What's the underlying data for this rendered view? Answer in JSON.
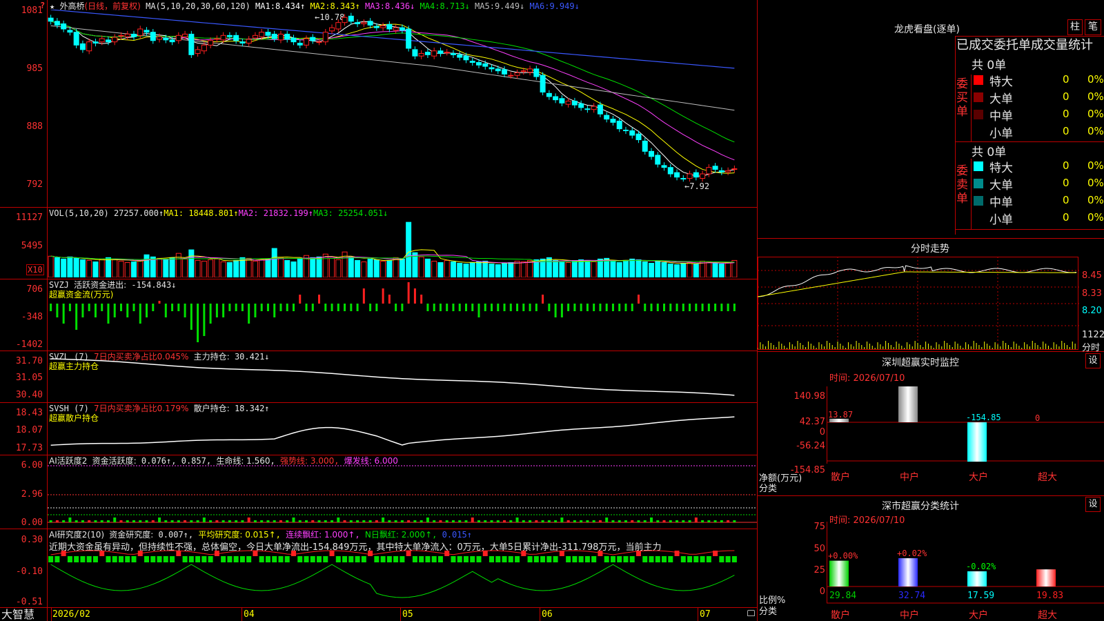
{
  "kline": {
    "star": "★",
    "name": "外高桥",
    "period": "(日线，前复权)",
    "ma_label": "MA(5,10,20,30,60,120)",
    "mas": [
      {
        "label": "MA1:",
        "value": "8.434↑",
        "color": "#ffffff"
      },
      {
        "label": "MA2:",
        "value": "8.343↑",
        "color": "#ffff00"
      },
      {
        "label": "MA3:",
        "value": "8.436↓",
        "color": "#ff40ff"
      },
      {
        "label": "MA4:",
        "value": "8.713↓",
        "color": "#00e000"
      },
      {
        "label": "MA5:",
        "value": "9.449↓",
        "color": "#bdbdbd"
      },
      {
        "label": "MA6:",
        "value": "9.949↓",
        "color": "#3a58ff"
      }
    ],
    "y_ticks": [
      "1081",
      "985",
      "888",
      "792"
    ],
    "high_mark": "←10.78",
    "low_mark": "←7.92",
    "close_series": [
      10.72,
      10.66,
      10.6,
      10.55,
      10.35,
      10.28,
      10.4,
      10.38,
      10.45,
      10.4,
      10.47,
      10.5,
      10.52,
      10.48,
      10.6,
      10.55,
      10.42,
      10.48,
      10.43,
      10.4,
      10.5,
      10.52,
      10.2,
      10.28,
      10.35,
      10.42,
      10.45,
      10.5,
      10.48,
      10.42,
      10.38,
      10.44,
      10.5,
      10.55,
      10.5,
      10.45,
      10.52,
      10.44,
      10.4,
      10.35,
      10.45,
      10.42,
      10.4,
      10.55,
      10.62,
      10.7,
      10.78,
      10.72,
      10.68,
      10.7,
      10.66,
      10.62,
      10.65,
      10.6,
      10.62,
      10.58,
      10.3,
      10.18,
      10.22,
      10.2,
      10.26,
      10.22,
      10.24,
      10.2,
      10.16,
      10.12,
      10.08,
      10.04,
      10.02,
      9.98,
      9.95,
      9.9,
      9.88,
      9.92,
      9.95,
      9.98,
      9.86,
      9.62,
      9.55,
      9.5,
      9.45,
      9.48,
      9.42,
      9.38,
      9.35,
      9.4,
      9.28,
      9.2,
      9.15,
      9.05,
      9.02,
      8.95,
      8.88,
      8.7,
      8.62,
      8.5,
      8.45,
      8.35,
      8.3,
      8.28,
      8.35,
      8.3,
      8.35,
      8.45,
      8.42,
      8.38,
      8.4,
      8.43
    ]
  },
  "volume": {
    "header": "VOL(5,10,20)",
    "value": "27257.000↑",
    "mas": [
      {
        "label": "MA1:",
        "value": "18448.801↑",
        "color": "#ffff00"
      },
      {
        "label": "MA2:",
        "value": "21832.199↑",
        "color": "#ff40ff"
      },
      {
        "label": "MA3:",
        "value": "25254.051↓",
        "color": "#00e000"
      }
    ],
    "y_ticks": [
      "11127",
      "5495"
    ],
    "unit": "X10",
    "values": [
      3,
      2.8,
      2.6,
      2.9,
      2.7,
      2.5,
      2.4,
      2.2,
      2.6,
      2.8,
      2.5,
      2.3,
      2.1,
      2.2,
      2.4,
      3.2,
      2.9,
      2.7,
      2.5,
      2.8,
      3.4,
      2.6,
      3.9,
      2.4,
      2.3,
      2.5,
      2.6,
      2.2,
      2.1,
      2.4,
      2.8,
      2.7,
      2.3,
      2.5,
      2.6,
      4.1,
      2.8,
      2.4,
      2.2,
      2.6,
      3.1,
      2.8,
      2.9,
      3.3,
      2.7,
      2.5,
      3.6,
      2.9,
      2.4,
      2.2,
      2.6,
      2.5,
      2.3,
      2.4,
      2.8,
      2.6,
      7.8,
      3.5,
      2.9,
      2.6,
      2.3,
      2.1,
      2.4,
      2.2,
      2,
      1.9,
      2.1,
      2.2,
      2.3,
      1.9,
      1.8,
      2,
      2.1,
      2.3,
      2.2,
      2.4,
      2.5,
      2.6,
      2.8,
      2.4,
      2.2,
      2.1,
      2.3,
      2.5,
      2.4,
      2.2,
      2.6,
      2.7,
      2.3,
      2.1,
      2.4,
      2.6,
      2.5,
      2.2,
      2,
      2.3,
      2.1,
      1.9,
      1.8,
      2,
      2.1,
      1.9,
      2.3,
      2.2,
      2,
      1.9,
      2.1,
      2.4
    ]
  },
  "svzj": {
    "header": "SVZJ",
    "label": "活跃资金进出:",
    "value": "-154.843↓",
    "sub": "超赢资金流(万元)",
    "y_ticks": [
      "706",
      "-348",
      "-1402"
    ],
    "values": [
      -1,
      -2,
      -3,
      -1,
      -4,
      -2,
      -1,
      -2,
      -1,
      -3,
      -2,
      -1,
      -2,
      -1,
      -3,
      -2,
      -1,
      0,
      -2,
      -1,
      -1,
      -2,
      -4,
      -6,
      -5,
      -3,
      -2,
      -2,
      -1,
      -1,
      -1,
      -3,
      -2,
      -1,
      -1,
      -2,
      -1,
      -1,
      -1,
      1,
      -1,
      -1,
      1,
      -1,
      -1,
      -1,
      -1,
      -1,
      -1,
      2,
      -1,
      -1,
      2,
      1,
      -1,
      -1,
      3,
      2,
      1,
      -1,
      -1,
      -1,
      -1,
      -1,
      -1,
      -1,
      -1,
      -2,
      -1,
      -1,
      -1,
      -1,
      -1,
      -1,
      -1,
      -1,
      -1,
      1,
      -1,
      -2,
      -2,
      -1,
      -1,
      -1,
      -1,
      -1,
      -1,
      -1,
      -1,
      -1,
      -1,
      -1,
      1,
      -1,
      -1,
      -1,
      -1,
      -1,
      -1,
      -1,
      -1,
      -1,
      -1,
      -1,
      -1,
      -1,
      -1,
      -1
    ]
  },
  "svzl": {
    "header": "SVZL (7)",
    "label1": "7日内买卖净占比0.045%",
    "label2": "主力持仓:",
    "value": "30.421↓",
    "sub": "超赢主力持仓",
    "y_ticks": [
      "31.70",
      "31.05",
      "30.40"
    ]
  },
  "svsh": {
    "header": "SVSH (7)",
    "label1": "7日内买卖净占比0.179%",
    "label2": "散户持仓:",
    "value": "18.342↑",
    "sub": "超赢散户持仓",
    "y_ticks": [
      "18.43",
      "18.07",
      "17.73"
    ]
  },
  "ai1": {
    "header": "AI活跃度2",
    "label": "资金活跃度:",
    "v1": "0.076↑",
    "v2": "0.857",
    "life": "生命线: 1.560",
    "strong": "强势线: 3.000",
    "burst": "爆发线: 6.000",
    "y_ticks": [
      "6.00",
      "2.96",
      "0.00"
    ]
  },
  "ai2": {
    "header": "AI研究度2(10)",
    "label": "资金研究度:",
    "v1": "0.007↑",
    "avg": "平均研究度: 0.015↑",
    "red1": "连续飘红: 1.000↑",
    "red2": "N日飘红: 2.000↑",
    "v5": "0.015↑",
    "comment": "近期大资金虽有异动，但持续性不强，总体偏空，今日大单净流出-154.849万元，其中特大单净流入：0万元，大单5日累计净出-311.798万元，当前主力",
    "y_ticks": [
      "0.30",
      "-0.10",
      "-0.51"
    ]
  },
  "bottom": {
    "brand": "大智慧",
    "dates": [
      "2026/02",
      "04",
      "05",
      "06",
      "07"
    ]
  },
  "right": {
    "tiger_title": "龙虎看盘(逐单)",
    "btn_bar": "柱",
    "btn_pen": "笔",
    "stats_title": "已成交委托单成交量统计",
    "buy_total": "共 0单",
    "sell_total": "共 0单",
    "buy_side": "委买单",
    "sell_side": "委卖单",
    "buy_rows": [
      {
        "label": "特大",
        "count": "0",
        "pct": "0%",
        "color": "#ff0000"
      },
      {
        "label": "大单",
        "count": "0",
        "pct": "0%",
        "color": "#8b0000"
      },
      {
        "label": "中单",
        "count": "0",
        "pct": "0%",
        "color": "#5a0000"
      },
      {
        "label": "小单",
        "count": "0",
        "pct": "0%",
        "color": "#000000"
      }
    ],
    "sell_rows": [
      {
        "label": "特大",
        "count": "0",
        "pct": "0%",
        "color": "#00ffff"
      },
      {
        "label": "大单",
        "count": "0",
        "pct": "0%",
        "color": "#008b8b"
      },
      {
        "label": "中单",
        "count": "0",
        "pct": "0%",
        "color": "#006b6b"
      },
      {
        "label": "小单",
        "count": "0",
        "pct": "0%",
        "color": "#000000"
      }
    ],
    "intraday_title": "分时走势",
    "intraday_ticks": [
      "8.45",
      "8.33",
      "8.20"
    ],
    "intraday_vol": "1122",
    "intraday_unit": "分时",
    "monitor_title": "深圳超赢实时监控",
    "set_btn": "设",
    "monitor_time": "时间: 2026/07/10",
    "monitor_ticks": [
      "140.98",
      "42.37",
      "0",
      "-56.24",
      "-154.85"
    ],
    "net_label": "净额(万元)",
    "cat_label": "分类",
    "monitor_bars": [
      {
        "cat": "散户",
        "value": 13.87,
        "label": "13.87"
      },
      {
        "cat": "中户",
        "value": 140.98,
        "label": "140.98"
      },
      {
        "cat": "大户",
        "value": -154.85,
        "label": "-154.85"
      },
      {
        "cat": "超大",
        "value": 0,
        "label": "0"
      }
    ],
    "class_title": "深市超赢分类统计",
    "class_time": "时间: 2026/07/10",
    "class_ticks": [
      "75",
      "50",
      "25",
      "0"
    ],
    "ratio_label": "比例%",
    "class_bars": [
      {
        "cat": "散户",
        "value": 29.84,
        "label": "29.84",
        "chg": "+0.00%",
        "color": "#00d000"
      },
      {
        "cat": "中户",
        "value": 32.74,
        "label": "32.74",
        "chg": "+0.02%",
        "color": "#2a2aff"
      },
      {
        "cat": "大户",
        "value": 17.59,
        "label": "17.59",
        "chg": "-0.02%",
        "color": "#00ffff"
      },
      {
        "cat": "超大",
        "value": 19.83,
        "label": "19.83",
        "chg": "",
        "color": "#ff2020"
      }
    ]
  }
}
